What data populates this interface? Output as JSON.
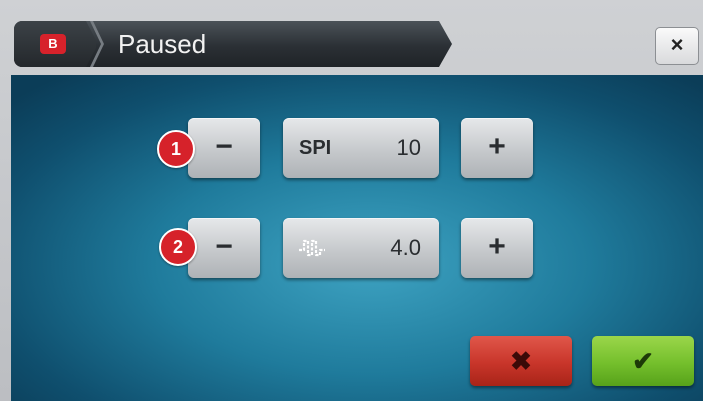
{
  "header": {
    "logo_letter": "B",
    "title": "Paused",
    "close_glyph": "×"
  },
  "controls": {
    "row1": {
      "badge": "1",
      "minus": "−",
      "label": "SPI",
      "value": "10",
      "plus": "+"
    },
    "row2": {
      "badge": "2",
      "minus": "−",
      "icon": "stitch-length-icon",
      "value": "4.0",
      "plus": "+"
    }
  },
  "actions": {
    "cancel_glyph": "✖",
    "confirm_glyph": "✔"
  },
  "colors": {
    "accent_red": "#d6222a",
    "confirm_green": "#74bf2c",
    "cancel_red": "#c8352a",
    "screen_blue": "#1f7b9c"
  }
}
